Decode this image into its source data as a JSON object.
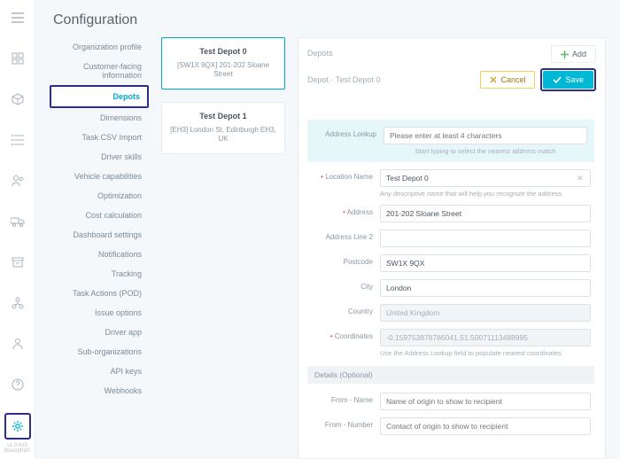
{
  "page_title": "Configuration",
  "rail": {
    "caption": "v1.0.415\\nMaxoptra©"
  },
  "nav": {
    "items": [
      "Organization profile",
      "Customer-facing information",
      "Depots",
      "Dimensions",
      "Task CSV Import",
      "Driver skills",
      "Vehicle capabilities",
      "Optimization",
      "Cost calculation",
      "Dashboard settings",
      "Notifications",
      "Tracking",
      "Task Actions (POD)",
      "Issue options",
      "Driver app",
      "Sub-organizations",
      "API keys",
      "Webhooks"
    ],
    "active_index": 2
  },
  "depots_header_label": "Depots",
  "add_label": "Add",
  "cards": [
    {
      "name": "Test Depot 0",
      "addr": "[SW1X 9QX] 201-202 Sloane Street"
    },
    {
      "name": "Test Depot 1",
      "addr": "[EH3] London St, Edinburgh EH3, UK"
    }
  ],
  "detail": {
    "breadcrumb": "Depot · Test Depot 0",
    "cancel_label": "Cancel",
    "save_label": "Save",
    "lookup": {
      "label": "Address Lookup",
      "placeholder": "Please enter at least 4 characters",
      "help": "Start typing to select the nearest address match"
    },
    "fields": {
      "location_name": {
        "label": "Location Name",
        "value": "Test Depot 0",
        "help": "Any descriptive name that will help you recognize the address"
      },
      "address": {
        "label": "Address",
        "value": "201-202 Sloane Street"
      },
      "address2": {
        "label": "Address Line 2",
        "value": ""
      },
      "postcode": {
        "label": "Postcode",
        "value": "SW1X 9QX"
      },
      "city": {
        "label": "City",
        "value": "London"
      },
      "country": {
        "label": "Country",
        "value": "United Kingdom"
      },
      "coordinates": {
        "label": "Coordinates",
        "value": "-0.159753878786041,51.50071113488995",
        "help": "Use the Address Lookup field to populate nearest coordinates"
      }
    },
    "details_section": "Details (Optional)",
    "from_name": {
      "label": "From - Name",
      "placeholder": "Name of origin to show to recipient"
    },
    "from_number": {
      "label": "From - Number",
      "placeholder": "Contact of origin to show to recipient"
    }
  }
}
